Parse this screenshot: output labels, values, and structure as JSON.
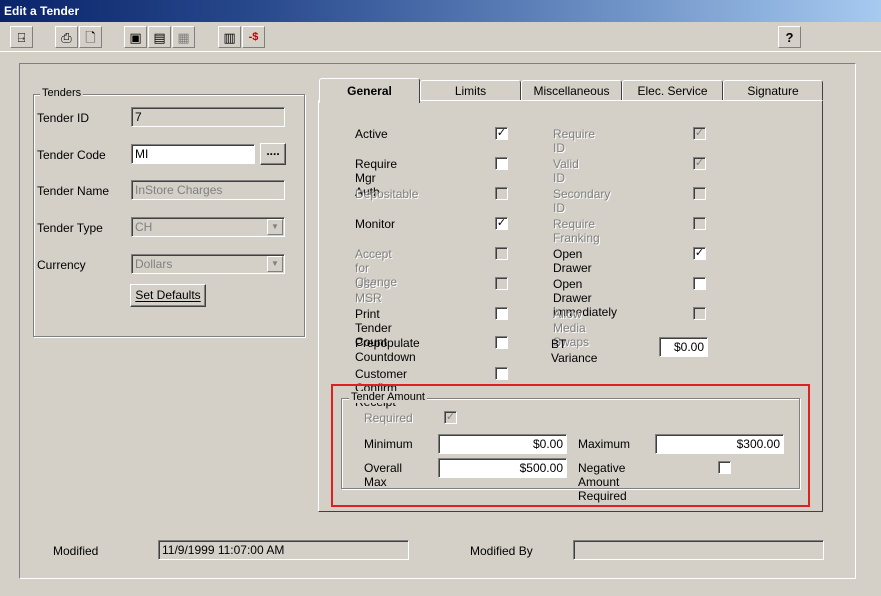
{
  "window": {
    "title": "Edit a Tender"
  },
  "toolbar": {
    "buttons": [
      {
        "name": "exit-button",
        "icon": "exit-door-icon",
        "glyph": "⍈"
      },
      {
        "name": "print-button",
        "icon": "printer-icon",
        "glyph": "⎙"
      },
      {
        "name": "print-preview-button",
        "icon": "print-preview-icon",
        "glyph": "🗋"
      },
      {
        "name": "save-button",
        "icon": "floppy-disk-icon",
        "glyph": "▣"
      },
      {
        "name": "save-new-button",
        "icon": "save-new-icon",
        "glyph": "▤"
      },
      {
        "name": "copy-button",
        "icon": "copy-icon",
        "glyph": "▦"
      },
      {
        "name": "report-button",
        "icon": "report-icon",
        "glyph": "▥"
      },
      {
        "name": "delete-tender-button",
        "icon": "delete-currency-icon",
        "glyph": "-$"
      },
      {
        "name": "help-button",
        "icon": "help-pointer-icon",
        "glyph": "?"
      }
    ]
  },
  "tenders": {
    "legend": "Tenders",
    "tender_id_label": "Tender ID",
    "tender_id": "7",
    "tender_code_label": "Tender Code",
    "tender_code": "MI",
    "browse_label": "....",
    "tender_name_label": "Tender Name",
    "tender_name": "InStore Charges",
    "tender_type_label": "Tender Type",
    "tender_type": "CH",
    "currency_label": "Currency",
    "currency": "Dollars",
    "set_defaults_label": "Set Defaults"
  },
  "tabs": [
    "General",
    "Limits",
    "Miscellaneous",
    "Elec. Service",
    "Signature"
  ],
  "general": {
    "left_options": [
      {
        "label": "Active",
        "checked": true,
        "enabled": true
      },
      {
        "label": "Require Mgr Auth",
        "checked": false,
        "enabled": true
      },
      {
        "label": "Depositable",
        "checked": false,
        "enabled": false
      },
      {
        "label": "Monitor",
        "checked": true,
        "enabled": true
      },
      {
        "label": "Accept for Change",
        "checked": false,
        "enabled": false
      },
      {
        "label": "Use MSR",
        "checked": false,
        "enabled": false
      },
      {
        "label": "Print Tender Count",
        "checked": false,
        "enabled": true
      },
      {
        "label": "Prepopulate Countdown",
        "checked": false,
        "enabled": true
      },
      {
        "label": "Customer Confirm Receipt",
        "checked": false,
        "enabled": true
      }
    ],
    "right_options": [
      {
        "label": "Require ID",
        "checked": true,
        "enabled": false
      },
      {
        "label": "Valid ID",
        "checked": true,
        "enabled": false
      },
      {
        "label": "Secondary ID",
        "checked": false,
        "enabled": false
      },
      {
        "label": "Require Franking",
        "checked": false,
        "enabled": false
      },
      {
        "label": "Open Drawer",
        "checked": true,
        "enabled": true
      },
      {
        "label": "Open Drawer immediately",
        "checked": false,
        "enabled": true
      },
      {
        "label": "Allow Media Swaps",
        "checked": false,
        "enabled": false
      }
    ],
    "bt_variance_label": "BT Variance",
    "bt_variance": "$0.00",
    "tender_amount": {
      "legend": "Tender Amount",
      "required_label": "Required",
      "required_checked": true,
      "minimum_label": "Minimum",
      "minimum": "$0.00",
      "maximum_label": "Maximum",
      "maximum": "$300.00",
      "overall_max_label": "Overall Max",
      "overall_max": "$500.00",
      "negative_required_label": "Negative Amount Required",
      "negative_required_checked": false
    },
    "check_glyph": "✓"
  },
  "footer": {
    "modified_label": "Modified",
    "modified": "11/9/1999 11:07:00 AM",
    "modified_by_label": "Modified By",
    "modified_by": ""
  },
  "colors": {
    "highlight": "#e02020",
    "title_gradient_start": "#0a246a",
    "title_gradient_end": "#a6caf0"
  }
}
